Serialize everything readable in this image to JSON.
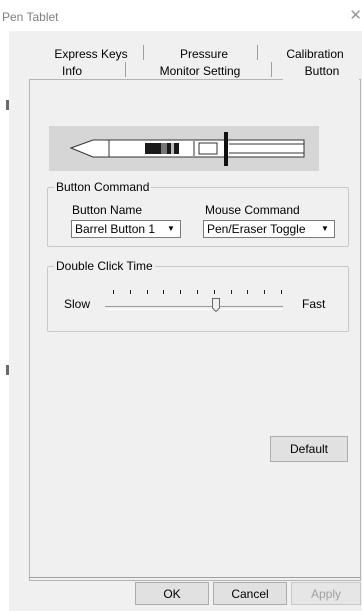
{
  "window": {
    "title": "Pen Tablet",
    "close_symbol": "✕"
  },
  "tabs_back": [
    "Express Keys",
    "Pressure",
    "Calibration"
  ],
  "tabs_front": [
    "Info",
    "Monitor Setting",
    "Button"
  ],
  "active_tab": "Button",
  "button_command": {
    "group_title": "Button Command",
    "button_name_label": "Button Name",
    "button_name_value": "Barrel Button 1",
    "mouse_command_label": "Mouse Command",
    "mouse_command_value": "Pen/Eraser Toggle"
  },
  "double_click": {
    "group_title": "Double Click Time",
    "slow_label": "Slow",
    "fast_label": "Fast",
    "tick_count": 11,
    "position_fraction": 0.6
  },
  "buttons": {
    "default": "Default",
    "ok": "OK",
    "cancel": "Cancel",
    "apply": "Apply"
  },
  "icons": {
    "close": "close-icon",
    "dropdown": "chevron-down-icon",
    "pen": "pen-illustration"
  },
  "colors": {
    "disabled_text": "#a0a0a0",
    "pen_bg": "#d6d6d6"
  }
}
